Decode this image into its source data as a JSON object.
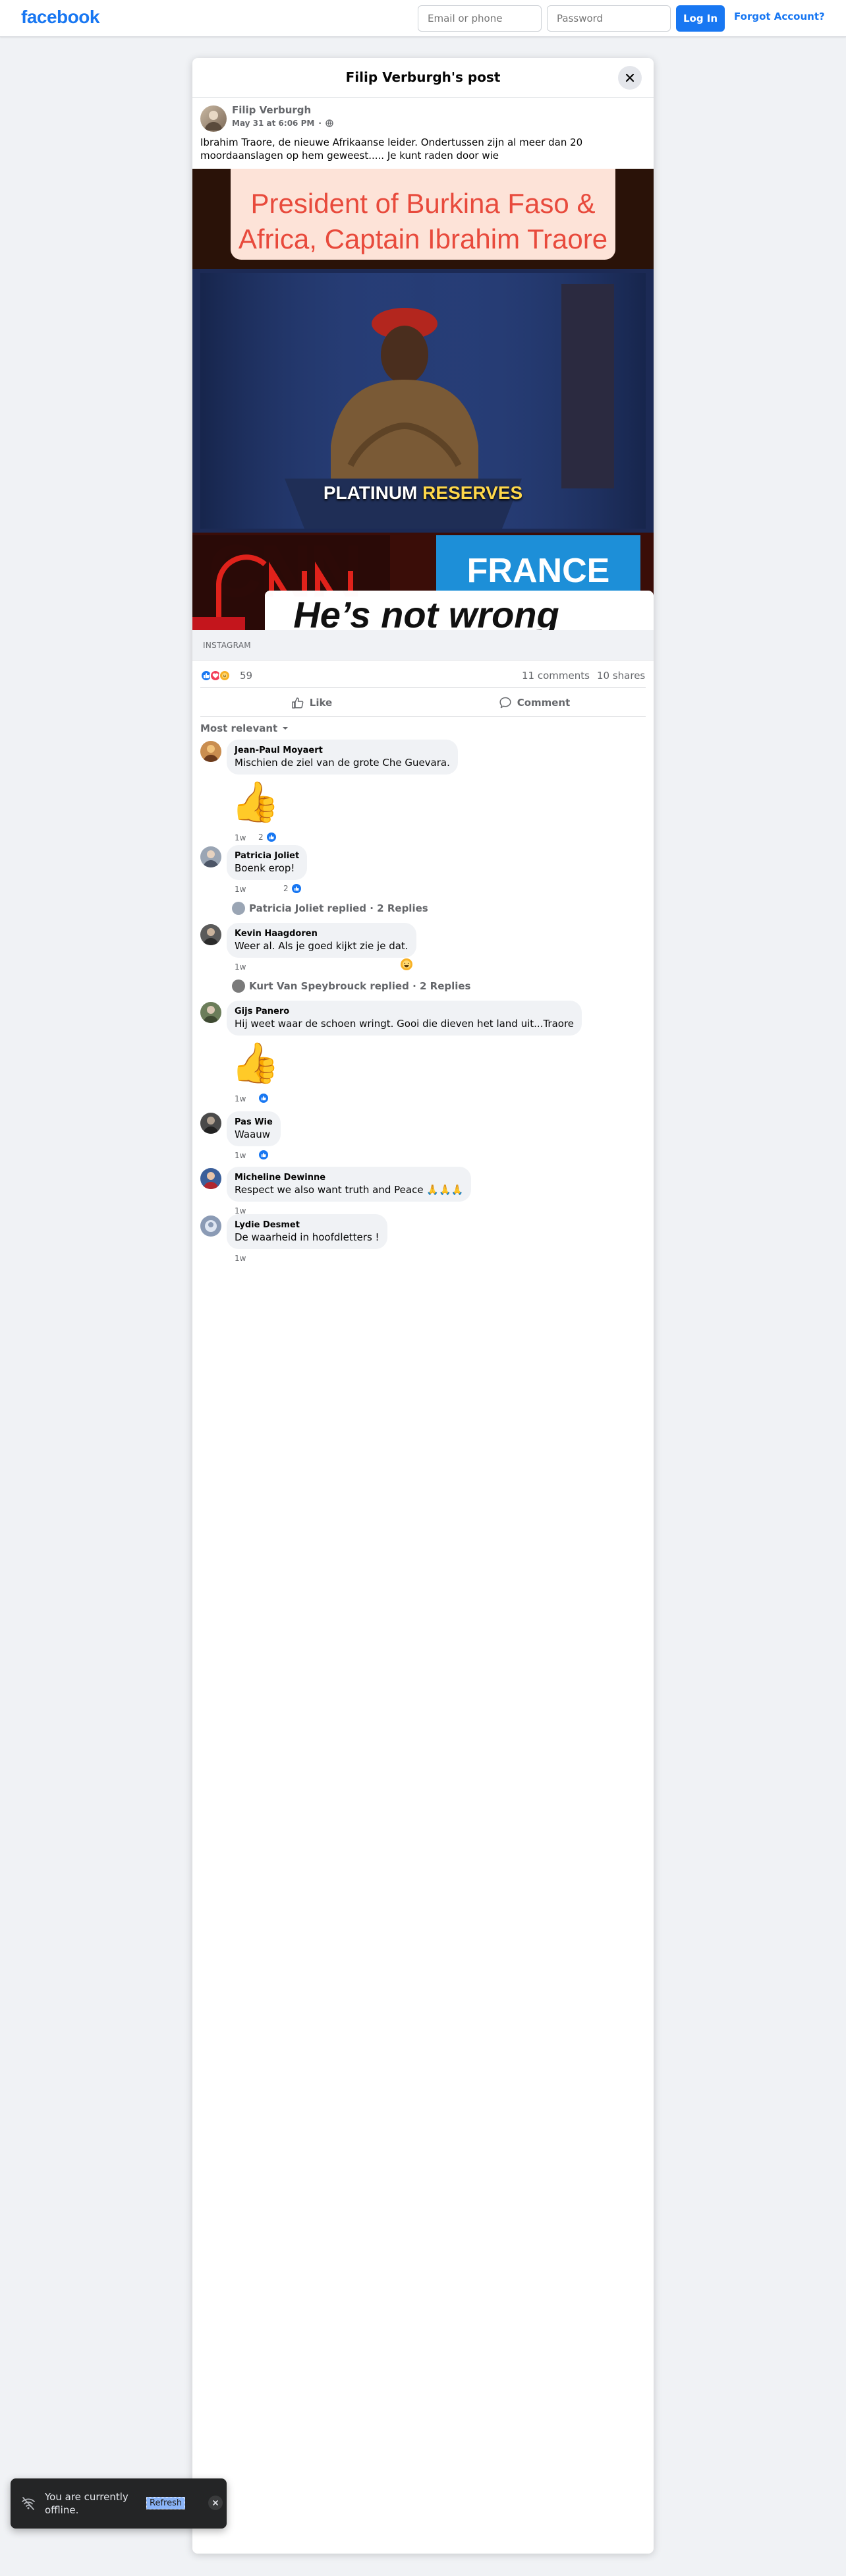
{
  "colors": {
    "brand": "#1877f2",
    "page_bg": "#f0f2f5"
  },
  "topbar": {
    "logo": "facebook",
    "email_placeholder": "Email or phone",
    "password_placeholder": "Password",
    "login_label": "Log In",
    "forgot_label": "Forgot Account?"
  },
  "post": {
    "dialog_title": "Filip Verburgh's post",
    "author": "Filip Verburgh",
    "timestamp": "May 31 at 6:06 PM",
    "privacy_icon": "globe-icon",
    "text": "Ibrahim Traore, de nieuwe Afrikaanse leider.  Ondertussen zijn al meer dan 20 moordaanslagen op hem geweest..... Je kunt raden door wie",
    "media": {
      "headline_line1": "President of Burkina Faso &",
      "headline_line2": "Africa, Captain Ibrahim Traore",
      "caption_white": "PLATINUM",
      "caption_yellow": "RESERVES",
      "logo_text": "CNN",
      "right_panel_text": "FRANCE",
      "overlay_text": "He’s not wrong"
    },
    "link_source": "INSTAGRAM",
    "reaction_count": "59",
    "comments_count": "11 comments",
    "shares_count": "10 shares",
    "like_label": "Like",
    "comment_label": "Comment",
    "sort_label": "Most relevant"
  },
  "comments": [
    {
      "name": "Jean-Paul Moyaert",
      "text": "Mischien de ziel van de grote Che Guevara.",
      "time": "1w",
      "likes": "2",
      "sticker": "thumbs-up"
    },
    {
      "name": "Patricia Joliet",
      "text": "Boenk erop!",
      "time": "1w",
      "likes": "2"
    },
    {
      "reply_summary": "Patricia Joliet replied · 2 Replies"
    },
    {
      "name": "Kevin Haagdoren",
      "text": "Weer al. Als je goed kijkt zie je dat.",
      "time": "1w"
    },
    {
      "reply_summary": "Kurt Van Speybrouck replied · 2 Replies"
    },
    {
      "name": "Gijs Panero",
      "text": "Hij weet waar de schoen wringt. Gooi die dieven het land uit...Traore",
      "time": "1w",
      "sticker": "thumbs-up"
    },
    {
      "name": "Pas Wie",
      "text": "Waauw",
      "time": "1w"
    },
    {
      "name": "Micheline Dewinne",
      "text": "Respect we also want truth and Peace 🙏🙏🙏",
      "time": "1w"
    },
    {
      "name": "Lydie Desmet",
      "text": "De waarheid in hoofdletters !",
      "time": "1w"
    }
  ],
  "toast": {
    "message": "You are currently offline.",
    "refresh_label": "Refresh"
  }
}
